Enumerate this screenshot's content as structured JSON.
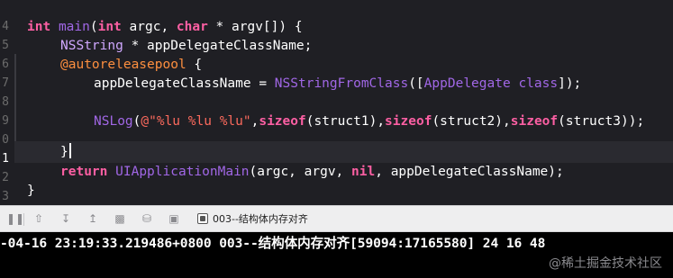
{
  "editor": {
    "line_numbers": [
      "4",
      "5",
      "6",
      "7",
      "8",
      "9",
      "0",
      "1",
      "2",
      "3"
    ],
    "code": {
      "l1": {
        "kw_int": "int",
        "fn_main": "main",
        "p1": "(",
        "kw_int2": "int",
        "p2": " argc, ",
        "kw_char": "char",
        "p3": " * argv[]) {"
      },
      "l2": {
        "type": "NSString",
        "rest": " * appDelegateClassName;"
      },
      "l3": {
        "dir": "@autoreleasepool",
        "rest": " {"
      },
      "l4": {
        "var": "appDelegateClassName = ",
        "fn": "NSStringFromClass",
        "p1": "([",
        "cls": "AppDelegate",
        "p2": " ",
        "meth": "class",
        "p3": "]);"
      },
      "l6": {
        "fn": "NSLog",
        "p1": "(",
        "str": "@\"%lu %lu %lu\"",
        "c1": ",",
        "k1": "sizeof",
        "a1": "(struct1)",
        "c2": ",",
        "k2": "sizeof",
        "a2": "(struct2)",
        "c3": ",",
        "k3": "sizeof",
        "a3": "(struct3));"
      },
      "l8": {
        "brace": "}"
      },
      "l9": {
        "kw": "return",
        "sp": " ",
        "fn": "UIApplicationMain",
        "p1": "(argc, argv, ",
        "nil": "nil",
        "p2": ", appDelegateClassName);"
      },
      "l10": {
        "brace": "}"
      }
    }
  },
  "debug_bar": {
    "icons": [
      "hide-debug-area-icon",
      "continue-icon",
      "step-over-icon",
      "step-into-icon",
      "step-out-icon",
      "debug-view-hierarchy-icon",
      "memory-graph-icon",
      "environment-overrides-icon",
      "simulate-location-icon"
    ],
    "target_label": "003--结构体内存对齐"
  },
  "console": {
    "output": "-04-16 23:19:33.219486+0800 003--结构体内存对齐[59094:17165580] 24 16 48",
    "watermark": "@稀土掘金技术社区"
  },
  "colors": {
    "editor_bg": "#1f1f24",
    "keyword": "#fc5fa3",
    "string": "#fc6a5d",
    "function": "#a167e6",
    "directive": "#fd8f3f",
    "toolbar_bg": "#eeeeef",
    "console_bg": "#000000"
  }
}
